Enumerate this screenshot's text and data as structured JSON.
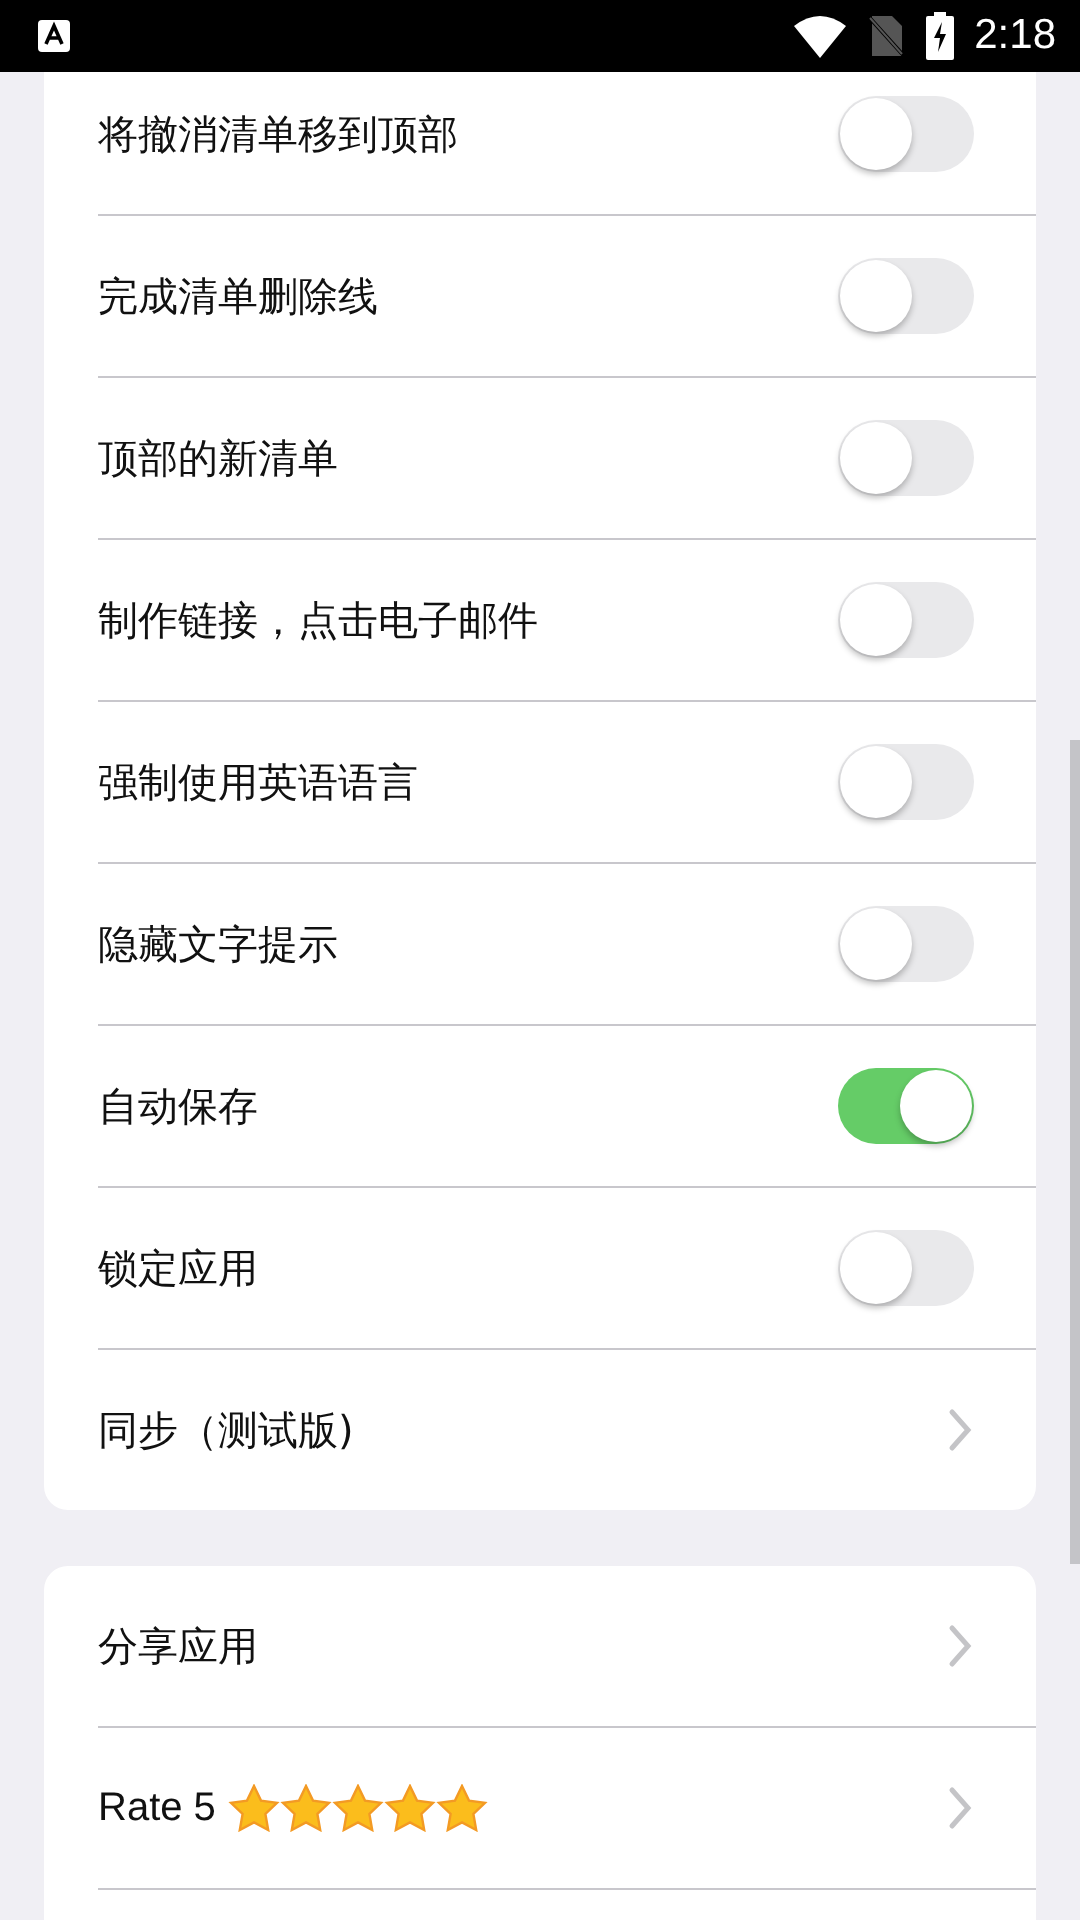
{
  "status_bar": {
    "time": "2:18"
  },
  "settings": [
    {
      "kind": "toggle",
      "label": "将撤消清单移到顶部",
      "on": false
    },
    {
      "kind": "toggle",
      "label": "完成清单删除线",
      "on": false
    },
    {
      "kind": "toggle",
      "label": "顶部的新清单",
      "on": false
    },
    {
      "kind": "toggle",
      "label": "制作链接，点击电子邮件",
      "on": false
    },
    {
      "kind": "toggle",
      "label": "强制使用英语语言",
      "on": false
    },
    {
      "kind": "toggle",
      "label": "隐藏文字提示",
      "on": false
    },
    {
      "kind": "toggle",
      "label": "自动保存",
      "on": true
    },
    {
      "kind": "toggle",
      "label": "锁定应用",
      "on": false
    },
    {
      "kind": "link",
      "label": "同步（测试版)"
    }
  ],
  "more": [
    {
      "kind": "link",
      "label": "分享应用"
    },
    {
      "kind": "rating",
      "label": "Rate 5",
      "stars": 5
    }
  ]
}
